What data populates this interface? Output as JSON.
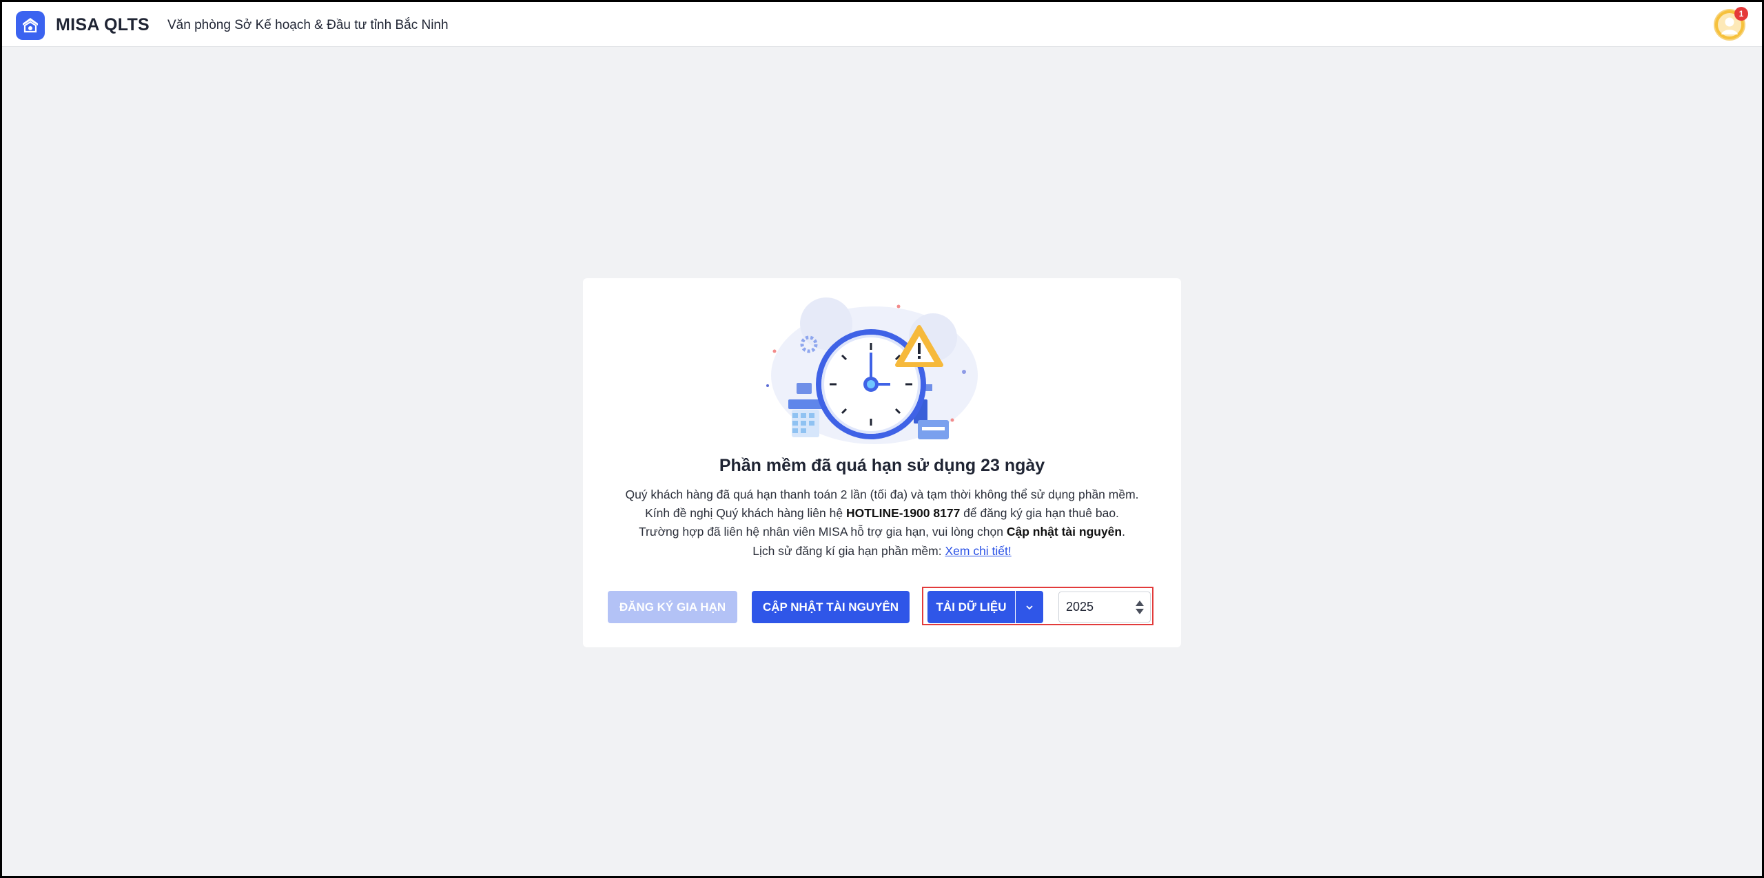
{
  "header": {
    "app_title": "MISA QLTS",
    "org_name": "Văn phòng Sở Kế hoạch & Đầu tư tỉnh Bắc Ninh",
    "notification_count": "1"
  },
  "notice": {
    "title": "Phần mềm đã quá hạn sử dụng 23 ngày",
    "line1": "Quý khách hàng đã quá hạn thanh toán 2 lần (tối đa) và tạm thời không thể sử dụng phần mềm.",
    "line2_prefix": "Kính đề nghị Quý khách hàng liên hệ ",
    "line2_hotline": "HOTLINE-1900 8177",
    "line2_suffix": " để đăng ký gia hạn thuê bao.",
    "line3_prefix": "Trường hợp đã liên hệ nhân viên MISA hỗ trợ gia hạn, vui lòng chọn ",
    "line3_bold": "Cập nhật tài nguyên",
    "line3_suffix": ".",
    "line4_prefix": "Lịch sử đăng kí gia hạn phần mềm: ",
    "line4_link": "Xem chi tiết!"
  },
  "actions": {
    "register_label": "ĐĂNG KÝ GIA HẠN",
    "update_label": "CẬP NHẬT TÀI NGUYÊN",
    "download_label": "TẢI DỮ LIỆU",
    "year_value": "2025"
  },
  "colors": {
    "primary": "#2f56e8",
    "primary_disabled": "#b3c2f6",
    "highlight": "#e23b3b",
    "warning": "#f6b93b"
  }
}
